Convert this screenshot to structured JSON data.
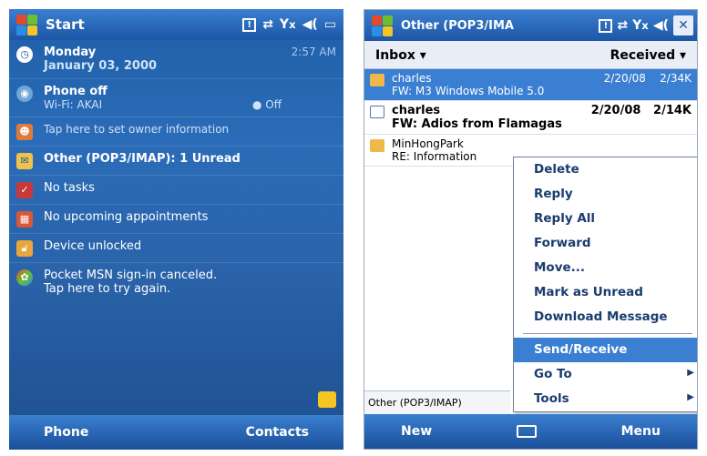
{
  "left": {
    "title": "Start",
    "clock": "2:57 AM",
    "day": "Monday",
    "date": "January 03, 2000",
    "phone_title": "Phone off",
    "wifi": "Wi-Fi: AKAI",
    "wifi_state": "Off",
    "owner_info": "Tap here to set owner information",
    "email": "Other (POP3/IMAP): 1 Unread",
    "tasks": "No tasks",
    "appointments": "No upcoming appointments",
    "device": "Device unlocked",
    "msn1": "Pocket MSN sign-in canceled.",
    "msn2": "Tap here to try again.",
    "soft_left": "Phone",
    "soft_right": "Contacts"
  },
  "right": {
    "title": "Other (POP3/IMA",
    "folder": "Inbox",
    "sort": "Received",
    "messages": [
      {
        "from": "charles",
        "date": "2/20/08",
        "size": "2/34K",
        "subject": "FW: M3 Windows Mobile 5.0"
      },
      {
        "from": "charles",
        "date": "2/20/08",
        "size": "2/14K",
        "subject": "FW: Adios from Flamagas"
      },
      {
        "from": "MinHongPark",
        "date": "",
        "size": "",
        "subject": "RE: Information"
      }
    ],
    "menu": [
      "Delete",
      "Reply",
      "Reply All",
      "Forward",
      "Move...",
      "Mark as Unread",
      "Download Message",
      "Send/Receive",
      "Go To",
      "Tools"
    ],
    "account_status": "Other (POP3/IMAP)",
    "soft_left": "New",
    "soft_right": "Menu"
  }
}
